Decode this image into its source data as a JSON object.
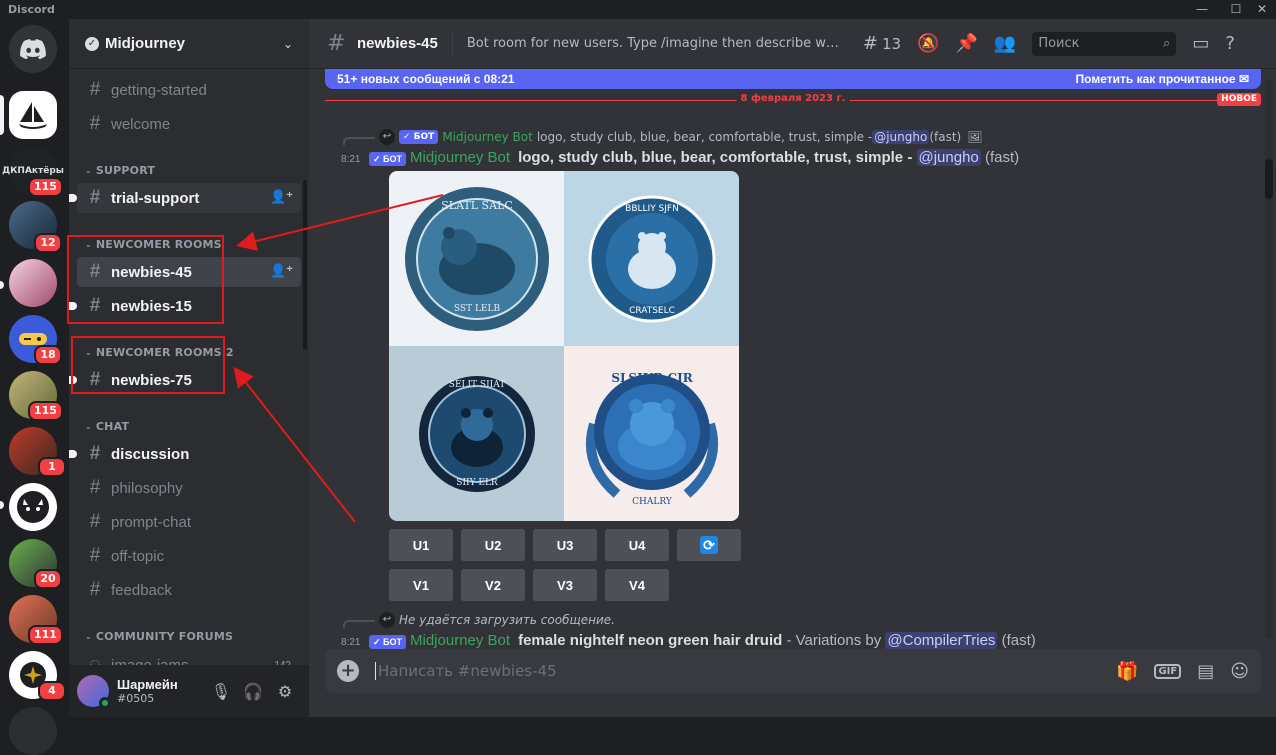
{
  "app": {
    "title": "Discord"
  },
  "window": {
    "minimize": "—",
    "maximize": "☐",
    "close": "✕"
  },
  "servers": {
    "items": [
      {
        "label": "",
        "badge": ""
      },
      {
        "label": "ДКПАктёры",
        "badge": "115"
      },
      {
        "label": "",
        "badge": "12"
      },
      {
        "label": "",
        "badge": ""
      },
      {
        "label": "",
        "badge": "18"
      },
      {
        "label": "",
        "badge": "115"
      },
      {
        "label": "",
        "badge": "1"
      },
      {
        "label": "",
        "badge": ""
      },
      {
        "label": "",
        "badge": "20"
      },
      {
        "label": "",
        "badge": "111"
      },
      {
        "label": "",
        "badge": "4"
      }
    ]
  },
  "guild": {
    "name": "Midjourney"
  },
  "sidebar": {
    "channels_top": [
      "getting-started",
      "welcome"
    ],
    "cat_support": "SUPPORT",
    "trial_support": "trial-support",
    "cat_newcomer": "NEWCOMER ROOMS",
    "newbies_45": "newbies-45",
    "newbies_15": "newbies-15",
    "cat_newcomer2": "NEWCOMER ROOMS 2",
    "newbies_75": "newbies-75",
    "cat_chat": "CHAT",
    "chat_channels": [
      "discussion",
      "philosophy",
      "prompt-chat",
      "off-topic",
      "feedback"
    ],
    "cat_forums": "COMMUNITY FORUMS",
    "forum_first": "image-jams",
    "forum_count": "142"
  },
  "user": {
    "name": "Шармейн",
    "tag": "#0505"
  },
  "header": {
    "channel": "newbies-45",
    "topic": "Bot room for new users. Type /imagine then describe what yo...",
    "threads_count": "13",
    "search_placeholder": "Поиск"
  },
  "banner": {
    "text": "51+ новых сообщений с 08:21",
    "mark_read": "Пометить как прочитанное"
  },
  "divider": {
    "date": "8 февраля 2023 г.",
    "new_tag": "НОВОЕ"
  },
  "messages": {
    "m1": {
      "reply_bot_tag": "✓ БОТ",
      "reply_author": "Midjourney Bot",
      "reply_text": "logo, study club, blue, bear, comfortable, trust, simple - ",
      "reply_mention": "@jungho",
      "reply_suffix": " (fast)",
      "time": "8:21",
      "bot_tag": "✓ БОТ",
      "author": "Midjourney Bot",
      "prompt": "logo, study club, blue, bear, comfortable, trust, simple",
      "dash": " - ",
      "mention": "@jungho",
      "suffix": " (fast)"
    },
    "images": [
      {
        "top": "SLATL SALC",
        "bottom": "SST LELB"
      },
      {
        "top": "BBLLIY SJFN",
        "bottom": "CRATSELC"
      },
      {
        "top": "SELIT SIIAT",
        "bottom": "SIIY ELR"
      },
      {
        "top": "SLSIUB CJR",
        "bottom": "CHALRY"
      }
    ],
    "buttons_u": [
      "U1",
      "U2",
      "U3",
      "U4"
    ],
    "refresh_icon": "⟳",
    "buttons_v": [
      "V1",
      "V2",
      "V3",
      "V4"
    ],
    "m2": {
      "reply_text": "Не удаётся загрузить сообщение.",
      "time": "8:21",
      "bot_tag": "✓ БОТ",
      "author": "Midjourney Bot",
      "prompt": "female nightelf neon green hair druid",
      "variations": " - Variations by ",
      "mention": "@CompilerTries",
      "suffix": " (fast)"
    }
  },
  "composer": {
    "placeholder": "Написать #newbies-45"
  },
  "colors": {
    "accent": "#5865f2",
    "annotation": "#e01b1b",
    "bot_name": "#3ba55c",
    "unread": "#f23f43"
  }
}
